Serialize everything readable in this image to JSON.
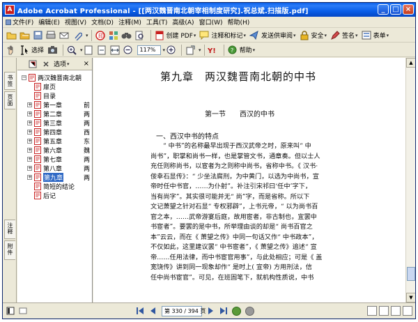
{
  "window": {
    "title": "Adobe Acrobat Professional - [[两汉魏晋南北朝宰相制度研究].祝总斌.扫描版.pdf]",
    "app_icon": "A"
  },
  "menu": [
    {
      "label": "文件(F)"
    },
    {
      "label": "编辑(E)"
    },
    {
      "label": "视图(V)"
    },
    {
      "label": "文档(D)"
    },
    {
      "label": "注释(M)"
    },
    {
      "label": "工具(T)"
    },
    {
      "label": "高级(A)"
    },
    {
      "label": "窗口(W)"
    },
    {
      "label": "帮助(H)"
    }
  ],
  "toolbar1": {
    "create_pdf": "创建 PDF",
    "comment_markup": "注释和标记",
    "send_review": "发送供审阅",
    "security": "安全",
    "sign": "签名",
    "forms": "表单"
  },
  "toolbar2": {
    "select_label": "选择",
    "zoom_value": "117%",
    "help_label": "帮助"
  },
  "side_tabs": {
    "bookmarks": "书签",
    "pages": "页面",
    "comments": "注释",
    "attachments": "附件"
  },
  "nav_panel": {
    "options_label": "选项",
    "tree": [
      {
        "label": "两汉魏晋南北朝",
        "expander": "−",
        "level": 0,
        "extra": ""
      },
      {
        "label": "扉页",
        "expander": "",
        "level": 1,
        "extra": ""
      },
      {
        "label": "目录",
        "expander": "",
        "level": 1,
        "extra": ""
      },
      {
        "label": "第一章",
        "expander": "+",
        "level": 1,
        "extra": "前"
      },
      {
        "label": "第二章",
        "expander": "+",
        "level": 1,
        "extra": "两"
      },
      {
        "label": "第三章",
        "expander": "+",
        "level": 1,
        "extra": "两"
      },
      {
        "label": "第四章",
        "expander": "+",
        "level": 1,
        "extra": "西"
      },
      {
        "label": "第五章",
        "expander": "+",
        "level": 1,
        "extra": "东"
      },
      {
        "label": "第六章",
        "expander": "+",
        "level": 1,
        "extra": "魏"
      },
      {
        "label": "第七章",
        "expander": "+",
        "level": 1,
        "extra": "两"
      },
      {
        "label": "第八章",
        "expander": "+",
        "level": 1,
        "extra": "两"
      },
      {
        "label": "第九章",
        "expander": "+",
        "level": 1,
        "extra": "两",
        "selected": true
      },
      {
        "label": "简短的结论",
        "expander": "",
        "level": 1,
        "extra": ""
      },
      {
        "label": "后记",
        "expander": "",
        "level": 1,
        "extra": ""
      }
    ]
  },
  "document": {
    "chapter_title": "第九章　两汉魏晋南北朝的中书",
    "section_title": "第一节　　西汉的中书",
    "subhead": "一、西汉中书的特点",
    "lines": [
      {
        "text": "“ 中书”的名称最早出现于西汉武帝之时，原来叫“ 中",
        "indent": true
      },
      {
        "text": "尚书”，职掌和尚书一样，也是掌管文书，通章奏。但以士人",
        "indent": false
      },
      {
        "text": "充任则称尚书，以宦者为之则称中尚书，省称中书。《 汉书·",
        "indent": false
      },
      {
        "text": "佞幸石显传》：“ 少坐法腐刑，为中黄门，以选为中尚书，宣",
        "indent": false
      },
      {
        "text": "帝时任中书官，……为仆射”。补注引宋祁曰‘任中’字下，",
        "indent": false
      },
      {
        "text": "当有尚字”。其实很可能并无“ 尚”字，而是省称。所以下",
        "indent": false
      },
      {
        "text": "文记萧望之针对石显“ 专权邪辟”，上书元帝，“ 以为尚书百",
        "indent": false
      },
      {
        "text": "官之本，……武帝游宴后庭，故用宦者，非古制也，宜罢中",
        "indent": false
      },
      {
        "text": "书宦者”。要罢的是中书，所举理由谈的却是“ 尚书百官之",
        "indent": false
      },
      {
        "text": "本”云云，而在《 萧望之传》中同一句话又作“ 中书政本”，",
        "indent": false
      },
      {
        "text": "不仅如此，这里建议罢“ 中书宦者”，《 萧望之传》追述“ 宣",
        "indent": false
      },
      {
        "text": "帝……任用法律，而中书宦官用事”，与此处相应；可是《 盖",
        "indent": false
      },
      {
        "text": "宽饶传》讲到同一现象却作“ 是时上( 宣帝) 方用刑法，信",
        "indent": false
      },
      {
        "text": "任中尚书宦官”。可见，在班固笔下，就机构性质说，中书",
        "indent": false
      }
    ]
  },
  "statusbar": {
    "page_indicator": "第 330 / 394 页"
  },
  "colors": {
    "titlebar": "#0a5ee8",
    "selection": "#316ac5",
    "pdf_red": "#c81e1e"
  }
}
